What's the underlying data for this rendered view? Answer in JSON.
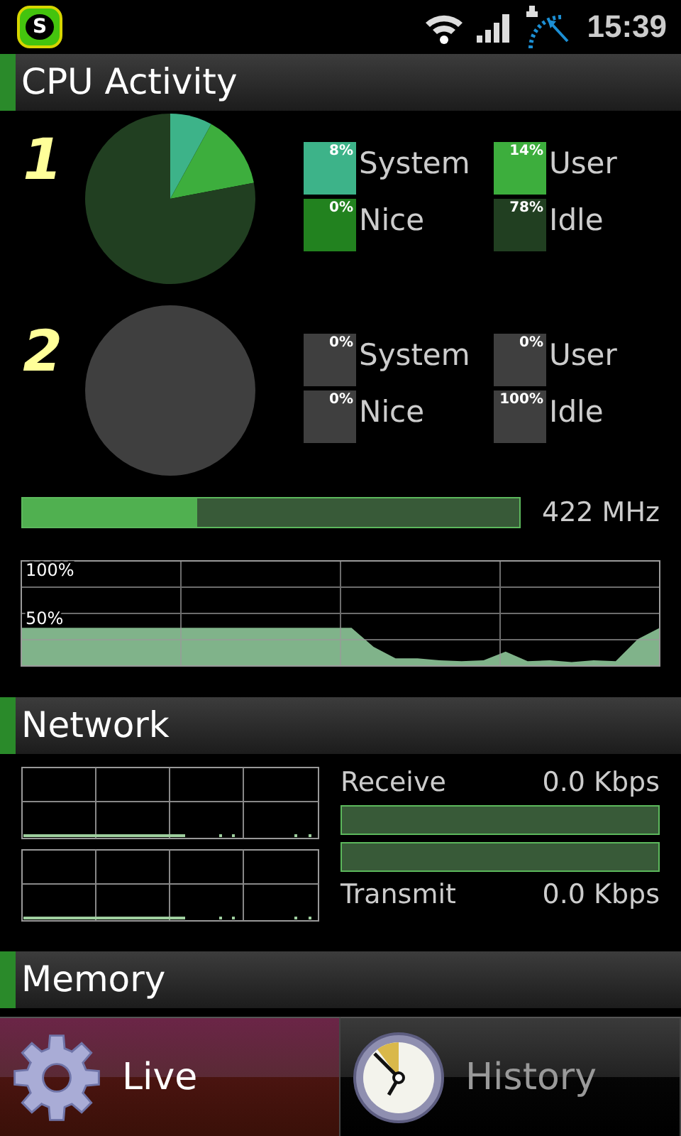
{
  "status_bar": {
    "notification_letter": "S",
    "time": "15:39"
  },
  "cpu": {
    "title": "CPU Activity",
    "cores": [
      {
        "number": "1",
        "legend": [
          {
            "label": "System",
            "percent": "8%",
            "color": "#3db389"
          },
          {
            "label": "User",
            "percent": "14%",
            "color": "#3dae3d"
          },
          {
            "label": "Nice",
            "percent": "0%",
            "color": "#22821f"
          },
          {
            "label": "Idle",
            "percent": "78%",
            "color": "#213f21"
          }
        ],
        "chart_data": {
          "type": "pie",
          "values": [
            8,
            14,
            0,
            78
          ]
        }
      },
      {
        "number": "2",
        "legend": [
          {
            "label": "System",
            "percent": "0%",
            "color": "#3f3f3f"
          },
          {
            "label": "User",
            "percent": "0%",
            "color": "#3f3f3f"
          },
          {
            "label": "Nice",
            "percent": "0%",
            "color": "#3f3f3f"
          },
          {
            "label": "Idle",
            "percent": "100%",
            "color": "#3f3f3f"
          }
        ],
        "chart_data": {
          "type": "pie",
          "values": [
            0,
            0,
            0,
            100
          ]
        }
      }
    ],
    "frequency": {
      "level": 0.35,
      "reading": "422 MHz"
    },
    "history": {
      "chart_data": {
        "type": "area",
        "ylim": [
          0,
          110
        ],
        "yticks": [
          {
            "value": 50,
            "label": "50%"
          },
          {
            "value": 100,
            "label": "100%"
          }
        ],
        "values": [
          40,
          40,
          40,
          40,
          40,
          40,
          40,
          40,
          40,
          40,
          40,
          40,
          40,
          40,
          40,
          40,
          20,
          8,
          8,
          6,
          5,
          6,
          15,
          5,
          6,
          4,
          6,
          5,
          28,
          40
        ]
      }
    }
  },
  "network": {
    "title": "Network",
    "receive": {
      "label": "Receive",
      "reading": "0.0 Kbps"
    },
    "transmit": {
      "label": "Transmit",
      "reading": "0.0 Kbps"
    }
  },
  "memory": {
    "title": "Memory"
  },
  "tabs": [
    {
      "label": "Live",
      "selected": true
    },
    {
      "label": "History",
      "selected": false
    }
  ]
}
